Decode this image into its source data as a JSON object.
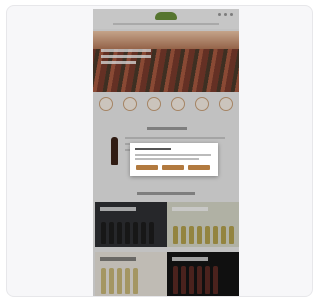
{
  "frame": {
    "background": "#f7f7f9",
    "border": "#e7e7ea"
  },
  "site_preview": {
    "hero_image": "vineyard-rows",
    "brand_color": "#6a8f3a",
    "accent_color": "#b27a3f",
    "category_icons": [
      "category-icon-1",
      "category-icon-2",
      "category-icon-3",
      "category-icon-4",
      "category-icon-5",
      "category-icon-6"
    ],
    "tiles": [
      {
        "name": "promo-tile-red-wines",
        "image": "bottle-lineup-dark"
      },
      {
        "name": "promo-tile-white-wines",
        "image": "bottle-lineup-light"
      },
      {
        "name": "promo-tile-featured",
        "image": "bottle-lineup-cream"
      },
      {
        "name": "promo-tile-collection",
        "image": "bottle-lineup-black"
      }
    ]
  },
  "cookie_modal": {
    "buttons": [
      "cookie-accept-button",
      "cookie-settings-button",
      "cookie-reject-button"
    ]
  }
}
